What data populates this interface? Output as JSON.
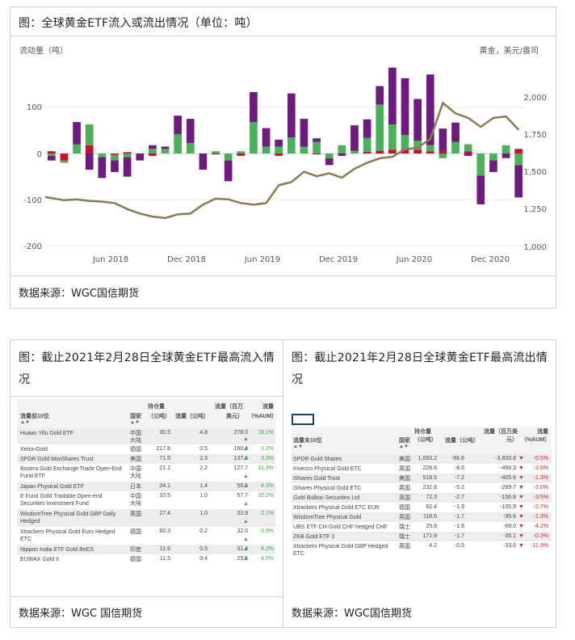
{
  "top_panel": {
    "title": "图：全球黄金ETF流入或流出情况（单位：吨）",
    "source": "数据来源：WGC国信期货"
  },
  "chart_data": {
    "type": "bar",
    "left_axis_label": "流动量（吨）",
    "right_axis_label": "黄金，美元/盎司",
    "left_ticks": [
      "100",
      "0",
      "-100",
      "-200"
    ],
    "right_ticks": [
      "2,000",
      "1,750",
      "1,500",
      "1,250",
      "1,000"
    ],
    "x_ticks": [
      "Jun 2018",
      "Dec 2018",
      "Jun 2019",
      "Dec 2019",
      "Jun 2020",
      "Dec 2020"
    ],
    "ylim_left": [
      -200,
      160
    ],
    "ylim_right": [
      1000,
      2150
    ],
    "bar_colors": {
      "purple": "#6e1a7e",
      "green": "#4caf5a",
      "red": "#c8102e"
    },
    "line_color": "#8a7a52",
    "flows": [
      {
        "month": 1,
        "green": -5,
        "purple": -10,
        "red": 5
      },
      {
        "month": 2,
        "green": -5,
        "purple": 0,
        "red": -15
      },
      {
        "month": 3,
        "green": 20,
        "purple": 48,
        "red": 0
      },
      {
        "month": 4,
        "green": 45,
        "purple": -35,
        "red": 18
      },
      {
        "month": 5,
        "green": -8,
        "purple": -45,
        "red": 0
      },
      {
        "month": 6,
        "green": -12,
        "purple": -25,
        "red": -3
      },
      {
        "month": 7,
        "green": -8,
        "purple": -42,
        "red": 3
      },
      {
        "month": 8,
        "green": 0,
        "purple": -15,
        "red": 0
      },
      {
        "month": 9,
        "green": 10,
        "purple": 8,
        "red": -5
      },
      {
        "month": 10,
        "green": 10,
        "purple": 5,
        "red": 0
      },
      {
        "month": 11,
        "green": 42,
        "purple": 40,
        "red": 0
      },
      {
        "month": 12,
        "green": 23,
        "purple": 52,
        "red": 0
      },
      {
        "month": 13,
        "green": 0,
        "purple": -35,
        "red": 0
      },
      {
        "month": 14,
        "green": 5,
        "purple": 0,
        "red": -2
      },
      {
        "month": 15,
        "green": -15,
        "purple": -45,
        "red": 0
      },
      {
        "month": 16,
        "green": 5,
        "purple": 0,
        "red": -5
      },
      {
        "month": 17,
        "green": 68,
        "purple": 65,
        "red": 0
      },
      {
        "month": 18,
        "green": 15,
        "purple": 40,
        "red": 0
      },
      {
        "month": 19,
        "green": 15,
        "purple": 15,
        "red": -5
      },
      {
        "month": 20,
        "green": 35,
        "purple": 95,
        "red": 0
      },
      {
        "month": 21,
        "green": 15,
        "purple": 60,
        "red": 0
      },
      {
        "month": 22,
        "green": 25,
        "purple": 8,
        "red": -2
      },
      {
        "month": 23,
        "green": -10,
        "purple": -15,
        "red": 0
      },
      {
        "month": 24,
        "green": 18,
        "purple": -5,
        "red": 0
      },
      {
        "month": 25,
        "green": 6,
        "purple": 55,
        "red": 0
      },
      {
        "month": 26,
        "green": 30,
        "purple": 40,
        "red": 4
      },
      {
        "month": 27,
        "green": 100,
        "purple": 40,
        "red": 6
      },
      {
        "month": 28,
        "green": 55,
        "purple": 123,
        "red": 8
      },
      {
        "month": 29,
        "green": 30,
        "purple": 123,
        "red": 10
      },
      {
        "month": 30,
        "green": 20,
        "purple": 90,
        "red": 8
      },
      {
        "month": 31,
        "green": 13,
        "purple": 153,
        "red": 5
      },
      {
        "month": 32,
        "green": -10,
        "purple": 48,
        "red": 6
      },
      {
        "month": 33,
        "green": 25,
        "purple": 42,
        "red": 0
      },
      {
        "month": 34,
        "green": 15,
        "purple": -5,
        "red": 5
      },
      {
        "month": 35,
        "green": -48,
        "purple": -62,
        "red": 0
      },
      {
        "month": 36,
        "green": -15,
        "purple": -25,
        "red": 0
      },
      {
        "month": 37,
        "green": 18,
        "purple": -10,
        "red": 0
      },
      {
        "month": 38,
        "green": -25,
        "purple": -70,
        "red": 10
      }
    ],
    "gold_price": [
      1330,
      1310,
      1315,
      1305,
      1300,
      1290,
      1250,
      1220,
      1200,
      1190,
      1215,
      1220,
      1280,
      1320,
      1315,
      1290,
      1280,
      1290,
      1410,
      1430,
      1500,
      1470,
      1490,
      1460,
      1520,
      1560,
      1590,
      1600,
      1650,
      1660,
      1720,
      1960,
      1890,
      1860,
      1800,
      1860,
      1870,
      1780
    ]
  },
  "inflow_panel": {
    "title": "图：截止2021年2月28日全球黄金ETF最高流入情况",
    "source": "数据来源：WGC 国信期货",
    "headers": {
      "name": "流量前10位",
      "country": "国家",
      "holdings": "持仓量（公吨）",
      "flow_t": "流量（公吨）",
      "flow_usd": "流量（百万美元）",
      "flow_pct": "流量（%AUM）"
    },
    "rows": [
      {
        "name": "Huaan Yifu Gold ETF",
        "country": "中国大陆",
        "holdings": "30.5",
        "flow_t": "4.8",
        "flow_usd": "278.0",
        "pct": "18.1%"
      },
      {
        "name": "Xetra-Gold",
        "country": "德国",
        "holdings": "217.8",
        "flow_t": "0.5",
        "flow_usd": "160.4",
        "pct": "1.2%"
      },
      {
        "name": "SPDR Gold MiniShares Trust",
        "country": "美国",
        "holdings": "71.5",
        "flow_t": "2.3",
        "flow_usd": "137.6",
        "pct": "3.3%"
      },
      {
        "name": "Bosera Gold Exchange Trade Open-End Fund ETF",
        "country": "中国大陆",
        "holdings": "21.1",
        "flow_t": "2.2",
        "flow_usd": "127.7",
        "pct": "11.3%"
      },
      {
        "name": "Japan Physical Gold ETF",
        "country": "日本",
        "holdings": "24.1",
        "flow_t": "1.4",
        "flow_usd": "58.0",
        "pct": "4.3%"
      },
      {
        "name": "E Fund Gold Tradable Open-end Securities Investment Fund",
        "country": "中国大陆",
        "holdings": "10.5",
        "flow_t": "1.0",
        "flow_usd": "57.7",
        "pct": "10.2%"
      },
      {
        "name": "WisdomTree Physical Gold GBP Daily Hedged",
        "country": "英国",
        "holdings": "27.4",
        "flow_t": "1.0",
        "flow_usd": "33.9",
        "pct": "2.1%"
      },
      {
        "name": "Xtrackers Physical Gold Euro Hedged ETC",
        "country": "德国",
        "holdings": "60.3",
        "flow_t": "0.2",
        "flow_usd": "32.0",
        "pct": "0.9%"
      },
      {
        "name": "Nippon India ETF Gold BeES",
        "country": "印度",
        "holdings": "11.6",
        "flow_t": "0.5",
        "flow_usd": "31.4",
        "pct": "4.2%"
      },
      {
        "name": "EUWAX Gold II",
        "country": "德国",
        "holdings": "11.5",
        "flow_t": "0.4",
        "flow_usd": "29.5",
        "pct": "4.5%"
      }
    ]
  },
  "outflow_panel": {
    "title": "图：截止2021年2月28日全球黄金ETF最高流出情况",
    "source": "数据来源：WGC国信期货",
    "headers": {
      "name": "流量末10位",
      "country": "国家",
      "holdings": "持仓量（公吨）",
      "flow_t": "流量（公吨）",
      "flow_usd": "流量（百万美元）",
      "flow_pct": "流量（%AUM）"
    },
    "rows": [
      {
        "name": "SPDR Gold Shares",
        "country": "美国",
        "holdings": "1,093.2",
        "flow_t": "-66.6",
        "flow_usd": "-3,833.8",
        "pct": "-5.5%"
      },
      {
        "name": "Invesco Physical Gold ETC",
        "country": "英国",
        "holdings": "228.6",
        "flow_t": "-8.6",
        "flow_usd": "-498.3",
        "pct": "-3.5%"
      },
      {
        "name": "iShares Gold Trust",
        "country": "美国",
        "holdings": "519.5",
        "flow_t": "-7.2",
        "flow_usd": "-405.6",
        "pct": "-1.3%"
      },
      {
        "name": "iShares Physical Gold ETC",
        "country": "英国",
        "holdings": "232.8",
        "flow_t": "-5.2",
        "flow_usd": "-289.7",
        "pct": "-2.0%"
      },
      {
        "name": "Gold Bullion Securities Ltd",
        "country": "英国",
        "holdings": "72.3",
        "flow_t": "-2.7",
        "flow_usd": "-156.8",
        "pct": "-3.5%"
      },
      {
        "name": "Xtrackers Physical Gold ETC EUR",
        "country": "德国",
        "holdings": "62.4",
        "flow_t": "-1.9",
        "flow_usd": "-105.9",
        "pct": "-2.7%"
      },
      {
        "name": "WisdomTree Physical Gold",
        "country": "英国",
        "holdings": "118.5",
        "flow_t": "-1.7",
        "flow_usd": "-95.6",
        "pct": "-1.3%"
      },
      {
        "name": "UBS ETF CH-Gold CHF hedged CHF",
        "country": "瑞士",
        "holdings": "25.8",
        "flow_t": "-1.8",
        "flow_usd": "-69.0",
        "pct": "-4.2%"
      },
      {
        "name": "ZKB Gold ETF ‡",
        "country": "瑞士",
        "holdings": "171.9",
        "flow_t": "-1.7",
        "flow_usd": "-35.1",
        "pct": "-0.3%"
      },
      {
        "name": "Xtrackers Physical Gold GBP Hedged ETC",
        "country": "英国",
        "holdings": "4.2",
        "flow_t": "-0.5",
        "flow_usd": "-33.6",
        "pct": "-11.9%"
      }
    ]
  }
}
